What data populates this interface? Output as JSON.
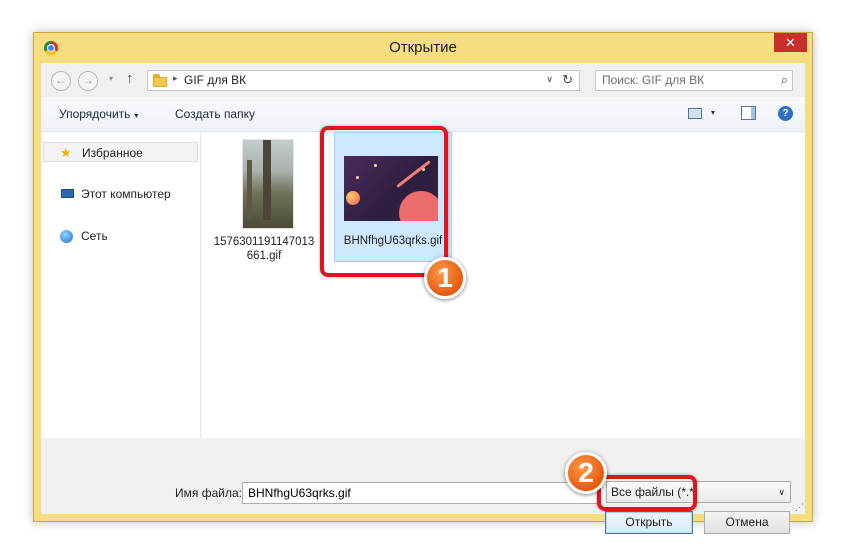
{
  "window": {
    "title": "Открытие",
    "close_symbol": "✕"
  },
  "address_bar": {
    "back_symbol": "←",
    "forward_symbol": "→",
    "history_dropdown_symbol": "▾",
    "up_symbol": "↑",
    "breadcrumb_separator": "▸",
    "path": "GIF для ВК",
    "dropdown_symbol": "∨",
    "refresh_symbol": "↻"
  },
  "search": {
    "placeholder": "Поиск: GIF для ВК",
    "icon_symbol": "⌕"
  },
  "toolbar": {
    "organize_label": "Упорядочить",
    "organize_arrow": "▾",
    "new_folder_label": "Создать папку",
    "view_dropdown_symbol": "▾",
    "help_symbol": "?"
  },
  "nav_pane": {
    "items": [
      {
        "label": "Избранное",
        "icon": "star-icon",
        "icon_symbol": "★",
        "selected": true
      },
      {
        "label": "Этот компьютер",
        "icon": "computer-icon",
        "selected": false
      },
      {
        "label": "Сеть",
        "icon": "network-icon",
        "selected": false
      }
    ]
  },
  "files": [
    {
      "name": "1576301191147013661.gif",
      "selected": false
    },
    {
      "name": "BHNfhgU63qrks.gif",
      "selected": true
    }
  ],
  "bottom": {
    "filename_label": "Имя файла:",
    "filename_value": "BHNfhgU63qrks.gif",
    "filetype_value": "Все файлы (*.*)",
    "filetype_dropdown_symbol": "∨",
    "open_label": "Открыть",
    "cancel_label": "Отмена",
    "resize_symbol": "⋰"
  },
  "annotations": {
    "step1": "1",
    "step2": "2"
  },
  "colors": {
    "window_frame": "#f5dd80",
    "close_button": "#c7302a",
    "selection": "#cde8ff",
    "highlight": "#e0141c",
    "badge": "#e55a0c"
  }
}
